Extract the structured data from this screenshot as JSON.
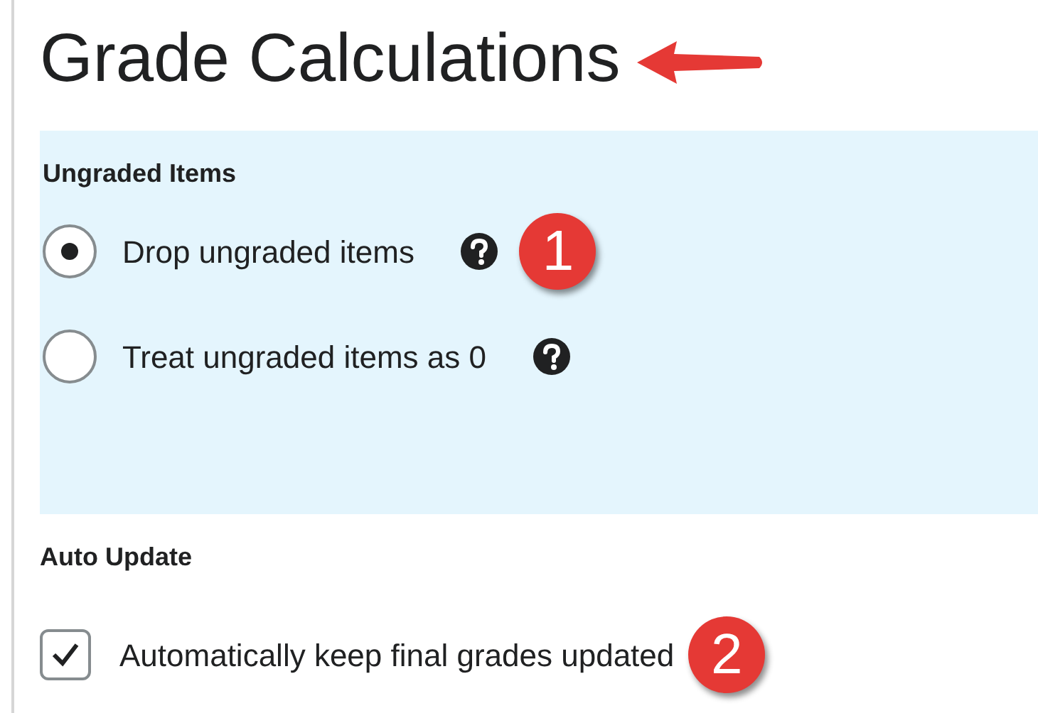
{
  "title": "Grade Calculations",
  "ungraded": {
    "heading": "Ungraded Items",
    "options": [
      {
        "label": "Drop ungraded items",
        "selected": true,
        "badge": "1"
      },
      {
        "label": "Treat ungraded items as 0",
        "selected": false
      }
    ]
  },
  "auto_update": {
    "heading": "Auto Update",
    "label": "Automatically keep final grades updated",
    "checked": true,
    "badge": "2"
  }
}
